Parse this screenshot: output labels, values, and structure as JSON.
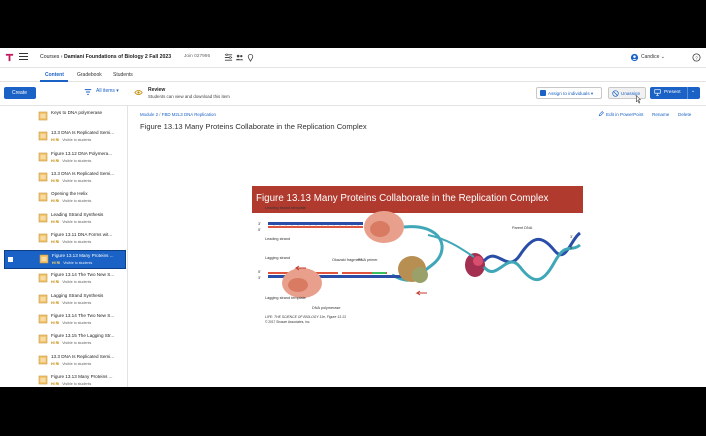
{
  "header": {
    "breadcrumb_root": "Courses",
    "course_title": "Damiani Foundations of Biology 2 Fall 2023",
    "join_code": "Join 027995",
    "user_name": "Candice"
  },
  "tabs": [
    "Content",
    "Gradebook",
    "Students"
  ],
  "actions": {
    "create_label": "Create",
    "filter_label": "All items",
    "review_title": "Review",
    "review_subtitle": "Students can view and download this item",
    "assign_label": "Assign to individuals",
    "unassign_label": "Unassign",
    "present_label": "Present"
  },
  "sidebar": {
    "items": [
      {
        "title": "Keys to DNA polymerase",
        "tag": "",
        "meta": ""
      },
      {
        "title": "13.3 DNA Is Replicated Semi...",
        "tag": "HI RI",
        "meta": "Visible to students"
      },
      {
        "title": "Figure 13.12 DNA Polymera...",
        "tag": "HI RI",
        "meta": "Visible to students"
      },
      {
        "title": "13.3 DNA Is Replicated Semi...",
        "tag": "HI RI",
        "meta": "Visible to students"
      },
      {
        "title": "Opening the Helix",
        "tag": "HI RI",
        "meta": "Visible to students"
      },
      {
        "title": "Leading Strand Synthesis",
        "tag": "HI RI",
        "meta": "Visible to students"
      },
      {
        "title": "Figure 13.11 DNA Forms wit...",
        "tag": "HI RI",
        "meta": "Visible to students"
      },
      {
        "title": "Figure 13.13 Many Proteins ...",
        "tag": "HI RI",
        "meta": "Visible to students"
      },
      {
        "title": "Figure 13.14 The Two New S...",
        "tag": "HI RI",
        "meta": "Visible to students"
      },
      {
        "title": "Lagging Strand Synthesis",
        "tag": "HI RI",
        "meta": "Visible to students"
      },
      {
        "title": "Figure 13.14 The Two New S...",
        "tag": "HI RI",
        "meta": "Visible to students"
      },
      {
        "title": "Figure 13.15 The Lagging Str...",
        "tag": "HI RI",
        "meta": "Visible to students"
      },
      {
        "title": "13.3 DNA Is Replicated Semi...",
        "tag": "HI RI",
        "meta": "Visible to students"
      },
      {
        "title": "Figure 13.13 Many Proteins ...",
        "tag": "HI RI",
        "meta": "Visible to students"
      }
    ]
  },
  "main": {
    "breadcrumb_module": "Module 2",
    "breadcrumb_sep": "/",
    "breadcrumb_folder": "FBD M2L3 DNA Replication",
    "page_title": "Figure 13.13 Many Proteins Collaborate in the Replication Complex",
    "edit_link": "Edit in PowerPoint",
    "rename_link": "Rename",
    "delete_link": "Delete"
  },
  "figure": {
    "banner": "Figure 13.13  Many Proteins Collaborate in the Replication Complex",
    "labels": {
      "leading_template": "Leading strand template",
      "leading": "Leading strand",
      "lagging": "Lagging strand",
      "okazaki": "Okazaki fragment",
      "primer": "RNA primer",
      "lagging_template": "Lagging strand template",
      "polymerase": "DNA polymerase",
      "parent": "Parent DNA",
      "three": "3'",
      "five": "5'"
    },
    "caption": "LIFE: THE SCIENCE OF BIOLOGY 11e, Figure 13.13",
    "copyright": "© 2017 Sinauer Associates, Inc."
  },
  "colors": {
    "accent": "#1a62c5",
    "banner": "#b03a2e"
  }
}
